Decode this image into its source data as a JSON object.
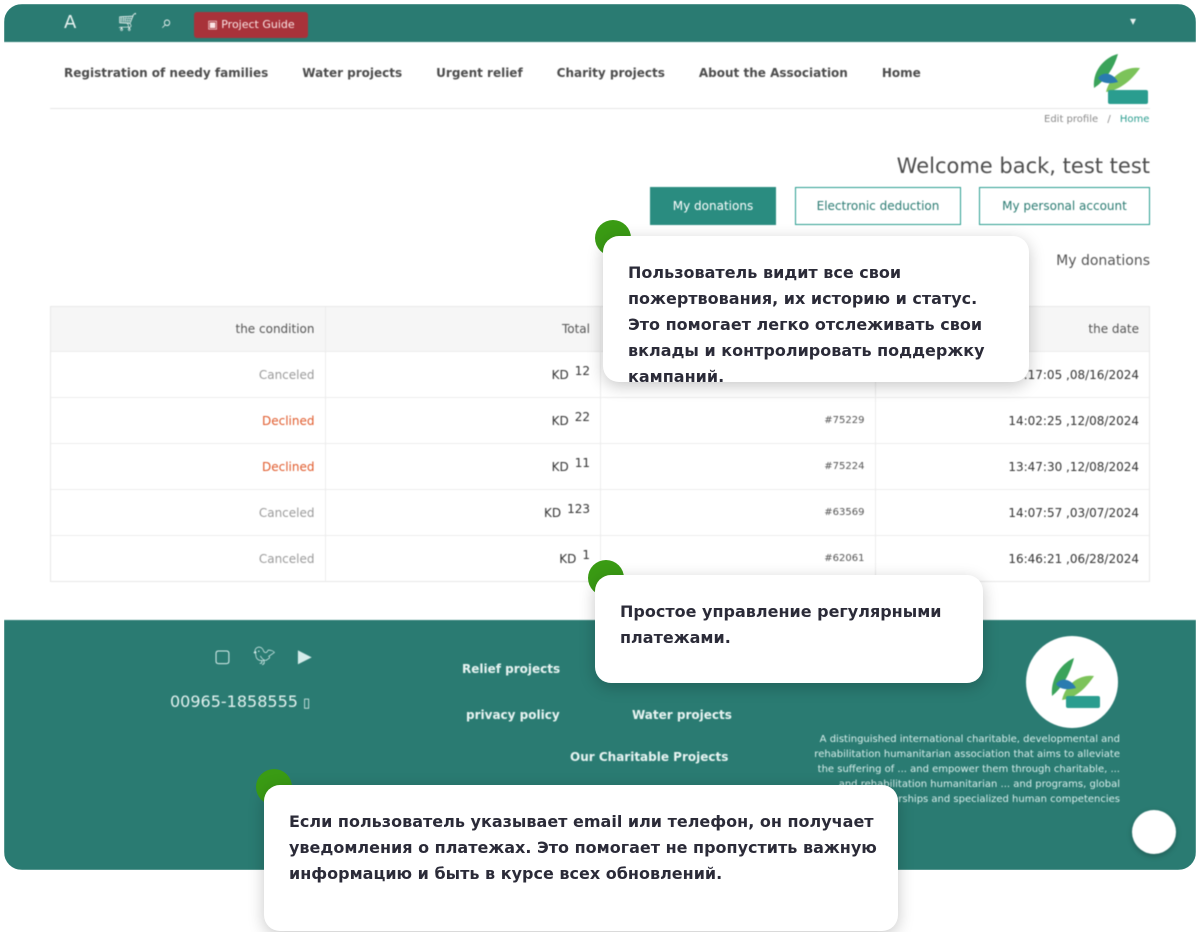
{
  "topbar": {
    "guide_label": "Project Guide",
    "lang": "▾"
  },
  "nav": {
    "items": [
      "Registration of needy families",
      "Water projects",
      "Urgent relief",
      "Charity projects",
      "About the Association",
      "Home"
    ]
  },
  "breadcrumb": {
    "edit_profile": "Edit profile",
    "separator": "/",
    "home": "Home"
  },
  "welcome": "Welcome back, test test",
  "tabs": {
    "my_donations": "My donations",
    "electronic_deduction": "Electronic deduction",
    "personal_account": "My personal account"
  },
  "section_title": "My donations",
  "table": {
    "headers": [
      "the condition",
      "Total",
      "",
      "the date"
    ],
    "rows": [
      {
        "condition": "Canceled",
        "status": "canceled",
        "currency": "KD",
        "amount": "12",
        "order": "",
        "date": "3:17:05 ,08/16/2024"
      },
      {
        "condition": "Declined",
        "status": "declined",
        "currency": "KD",
        "amount": "22",
        "order": "#75229",
        "date": "14:02:25 ,12/08/2024"
      },
      {
        "condition": "Declined",
        "status": "declined",
        "currency": "KD",
        "amount": "11",
        "order": "#75224",
        "date": "13:47:30 ,12/08/2024"
      },
      {
        "condition": "Canceled",
        "status": "canceled",
        "currency": "KD",
        "amount": "123",
        "order": "#63569",
        "date": "14:07:57 ,03/07/2024"
      },
      {
        "condition": "Canceled",
        "status": "canceled",
        "currency": "KD",
        "amount": "1",
        "order": "#62061",
        "date": "16:46:21 ,06/28/2024"
      }
    ]
  },
  "footer": {
    "phone": "00965-1858555",
    "links": {
      "relief": "Relief projects",
      "privacy": "privacy policy",
      "water": "Water projects",
      "charitable": "Our Charitable Projects"
    },
    "description": "A distinguished international charitable, developmental and rehabilitation humanitarian association that aims to alleviate the suffering of ... and empower them through charitable, ... and rehabilitation humanitarian ... and programs, global strategic partnerships and specialized human competencies"
  },
  "callouts": {
    "c1": "Пользователь видит все свои пожертвования, их историю и статус. Это помогает легко отслеживать свои вклады и контролировать поддержку кампаний.",
    "c2": "Простое управление регулярными платежами.",
    "c3": "Если пользователь указывает email или телефон, он получает уведомления о платежах. Это помогает не пропустить важную информацию и быть в курсе всех обновлений."
  },
  "colors": {
    "brand": "#2a7b72",
    "accent": "#2a9d8f",
    "declined": "#e05a2b",
    "dot": "#3a9b14"
  }
}
